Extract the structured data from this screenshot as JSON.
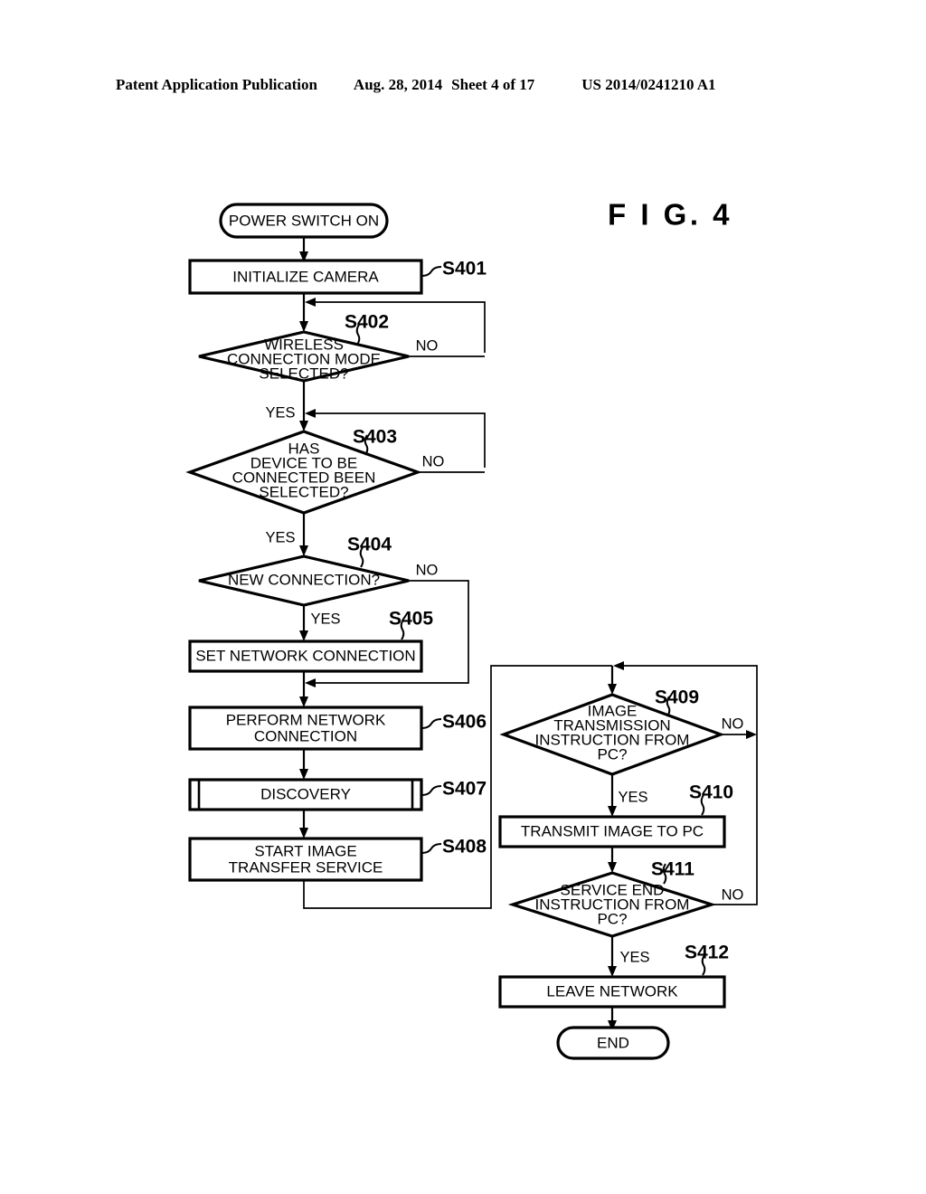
{
  "header": {
    "publication": "Patent Application Publication",
    "date": "Aug. 28, 2014",
    "sheet": "Sheet 4 of 17",
    "patent_number": "US 2014/0241210 A1"
  },
  "figure": {
    "title": "F I G.  4"
  },
  "flowchart": {
    "nodes": {
      "start": {
        "label": "POWER SWITCH ON",
        "type": "terminal"
      },
      "s401": {
        "label": "INITIALIZE CAMERA",
        "type": "process",
        "step": "S401"
      },
      "s402": {
        "label_line1": "WIRELESS",
        "label_line2": "CONNECTION MODE",
        "label_line3": "SELECTED?",
        "type": "decision",
        "step": "S402"
      },
      "s403": {
        "label_line1": "HAS",
        "label_line2": "DEVICE TO BE",
        "label_line3": "CONNECTED BEEN",
        "label_line4": "SELECTED?",
        "type": "decision",
        "step": "S403"
      },
      "s404": {
        "label": "NEW CONNECTION?",
        "type": "decision",
        "step": "S404"
      },
      "s405": {
        "label": "SET NETWORK CONNECTION",
        "type": "process",
        "step": "S405"
      },
      "s406": {
        "label_line1": "PERFORM NETWORK",
        "label_line2": "CONNECTION",
        "type": "process",
        "step": "S406"
      },
      "s407": {
        "label": "DISCOVERY",
        "type": "predefined-process",
        "step": "S407"
      },
      "s408": {
        "label_line1": "START IMAGE",
        "label_line2": "TRANSFER SERVICE",
        "type": "process",
        "step": "S408"
      },
      "s409": {
        "label_line1": "IMAGE",
        "label_line2": "TRANSMISSION",
        "label_line3": "INSTRUCTION FROM",
        "label_line4": "PC?",
        "type": "decision",
        "step": "S409"
      },
      "s410": {
        "label": "TRANSMIT IMAGE TO PC",
        "type": "process",
        "step": "S410"
      },
      "s411": {
        "label_line1": "SERVICE END",
        "label_line2": "INSTRUCTION FROM",
        "label_line3": "PC?",
        "type": "decision",
        "step": "S411"
      },
      "s412": {
        "label": "LEAVE NETWORK",
        "type": "process",
        "step": "S412"
      },
      "end": {
        "label": "END",
        "type": "terminal"
      }
    },
    "branches": {
      "s402_no": "NO",
      "s402_yes": "YES",
      "s403_no": "NO",
      "s403_yes": "YES",
      "s404_no": "NO",
      "s404_yes": "YES",
      "s409_no": "NO",
      "s409_yes": "YES",
      "s411_no": "NO",
      "s411_yes": "YES"
    }
  },
  "colors": {
    "ink": "#000000",
    "paper": "#ffffff"
  }
}
